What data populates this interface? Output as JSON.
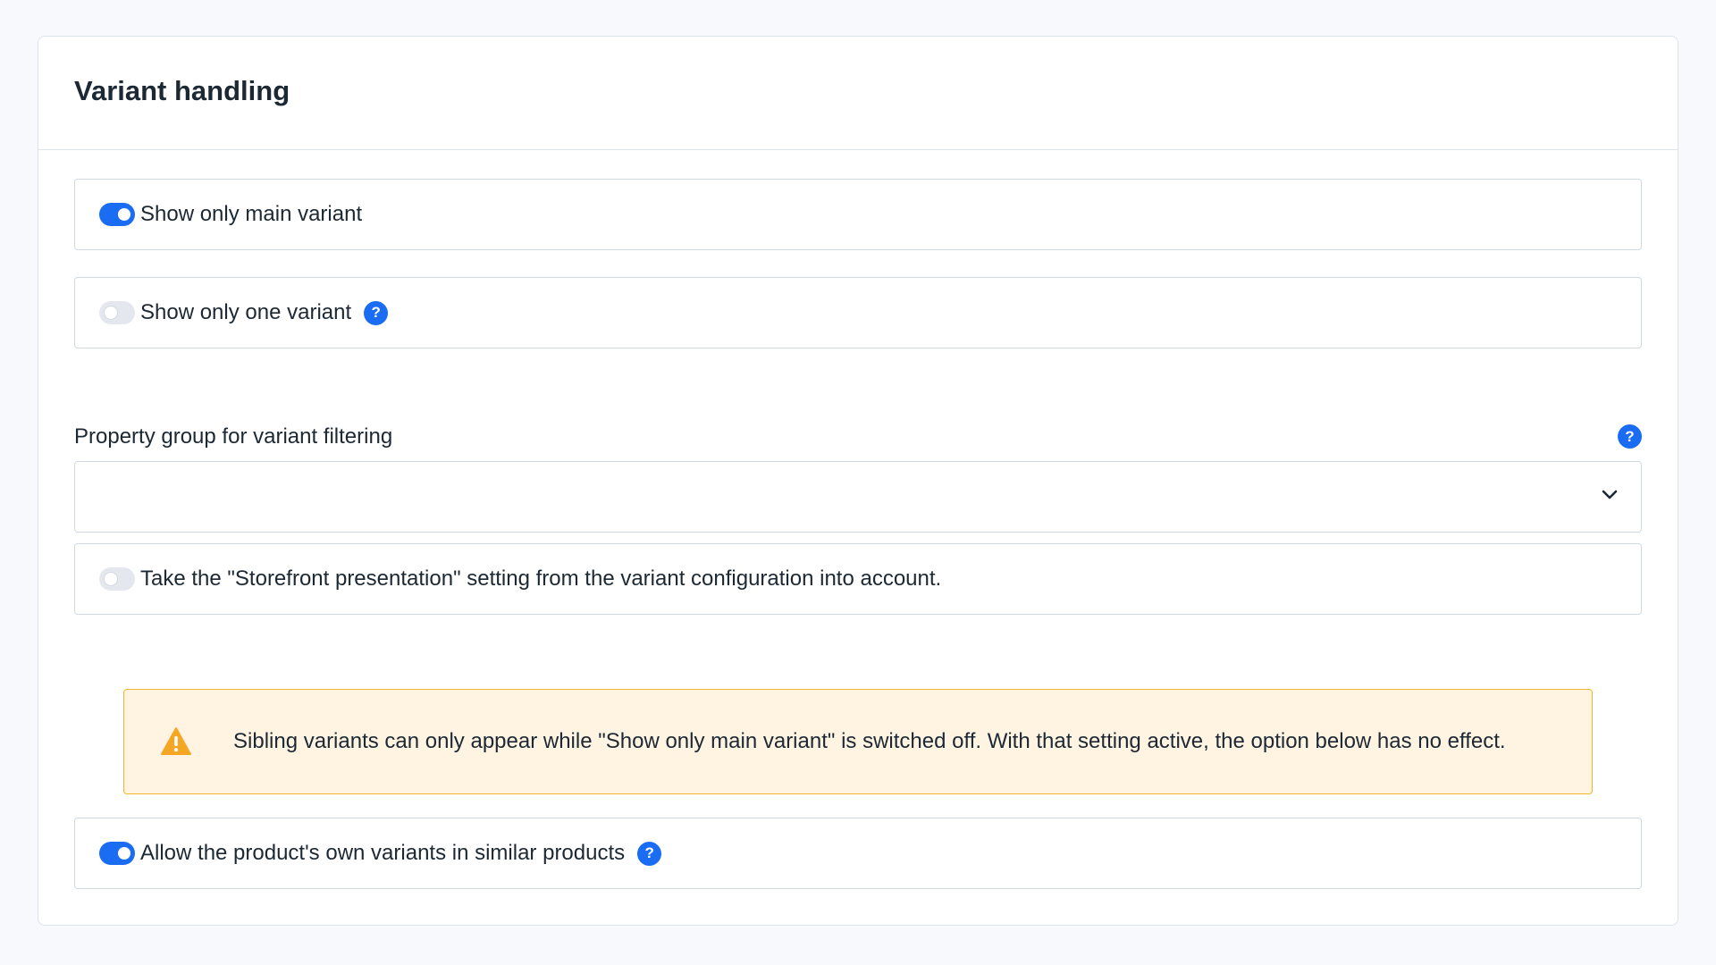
{
  "card": {
    "title": "Variant handling"
  },
  "fields": {
    "main_variant": {
      "label": "Show only main variant",
      "enabled": true
    },
    "one_variant": {
      "label": "Show only one variant",
      "enabled": false,
      "help_icon": "help-icon"
    },
    "property_group": {
      "label": "Property group for variant filtering",
      "value": "",
      "help_icon": "help-icon",
      "chevron_icon": "chevron-down-icon"
    },
    "storefront_presentation": {
      "label": "Take the \"Storefront presentation\" setting from the variant configuration into account.",
      "enabled": false
    },
    "own_variants": {
      "label": "Allow the product's own variants in similar products",
      "enabled": true,
      "help_icon": "help-icon"
    }
  },
  "alert": {
    "icon": "warning-icon",
    "text": "Sibling variants can only appear while \"Show only main variant\" is switched off. With that setting active, the option below has no effect."
  },
  "help_glyph": "?",
  "colors": {
    "accent": "#1a6cf2",
    "warning_border": "#f5b52d",
    "warning_background": "#fff3e2",
    "warning_icon": "#f5a623"
  }
}
